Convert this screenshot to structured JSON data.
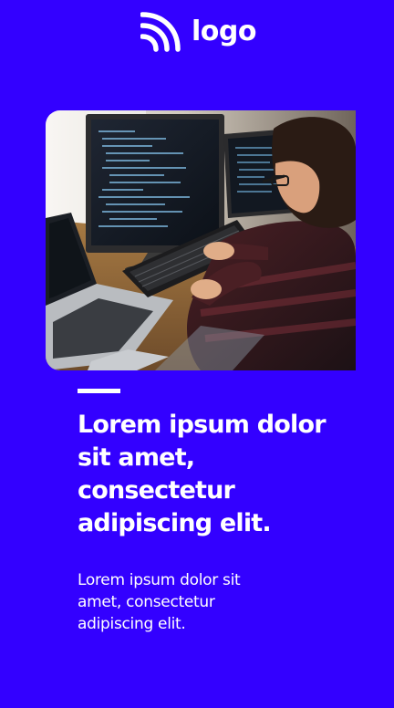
{
  "brand": {
    "logo_text": "logo",
    "logo_icon": "rss-feed-icon"
  },
  "hero": {
    "image_subject": "programmer-at-desk-with-monitors-and-laptop"
  },
  "content": {
    "headline": "Lorem ipsum dolor sit amet, consectetur adipiscing elit.",
    "body": "Lorem ipsum dolor sit amet, consectetur adipiscing elit."
  },
  "colors": {
    "background": "#3300ff",
    "text": "#ffffff"
  }
}
